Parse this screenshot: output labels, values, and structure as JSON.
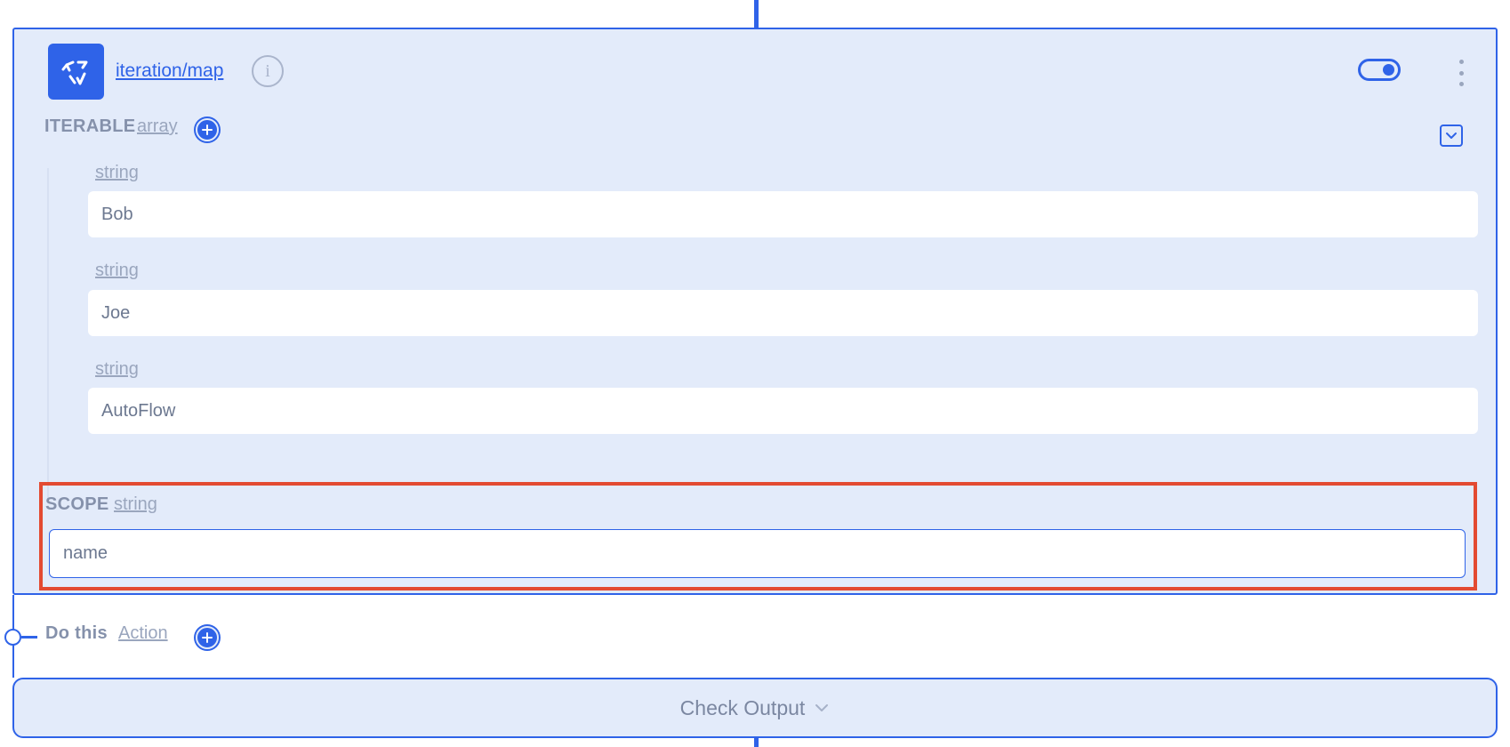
{
  "node": {
    "title": "iteration/map",
    "enabled": true
  },
  "iterable": {
    "label": "ITERABLE",
    "type": "array",
    "items": [
      {
        "type": "string",
        "value": "Bob"
      },
      {
        "type": "string",
        "value": "Joe"
      },
      {
        "type": "string",
        "value": "AutoFlow"
      }
    ]
  },
  "scope": {
    "label": "SCOPE",
    "type": "string",
    "value": "name"
  },
  "do_this": {
    "label": "Do this",
    "type": "Action"
  },
  "check_output": {
    "label": "Check Output"
  },
  "colors": {
    "accent": "#2f63e8",
    "card_bg": "#e3ebfa",
    "highlight": "#e34a31"
  }
}
